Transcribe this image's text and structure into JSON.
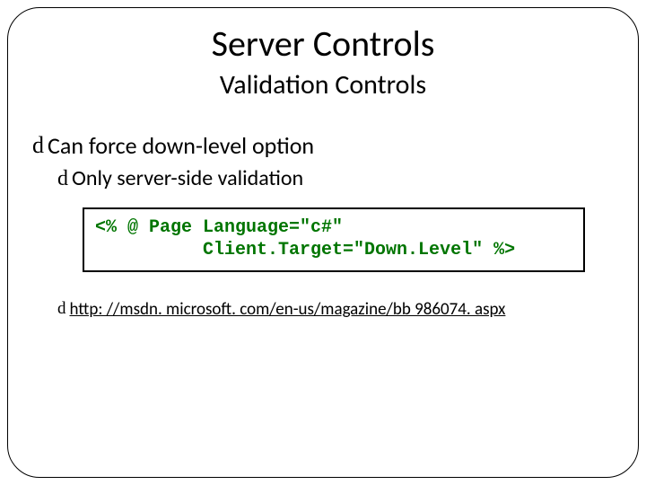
{
  "title": "Server Controls",
  "subtitle": "Validation Controls",
  "bullets": {
    "b1": "Can force down-level option",
    "b2": "Only server-side validation",
    "glyph": "d"
  },
  "code": {
    "line1": "<% @ Page Language=\"c#\"",
    "line2": "          Client.Target=\"Down.Level\" %>"
  },
  "link": {
    "text": "http: //msdn. microsoft. com/en-us/magazine/bb 986074. aspx"
  }
}
